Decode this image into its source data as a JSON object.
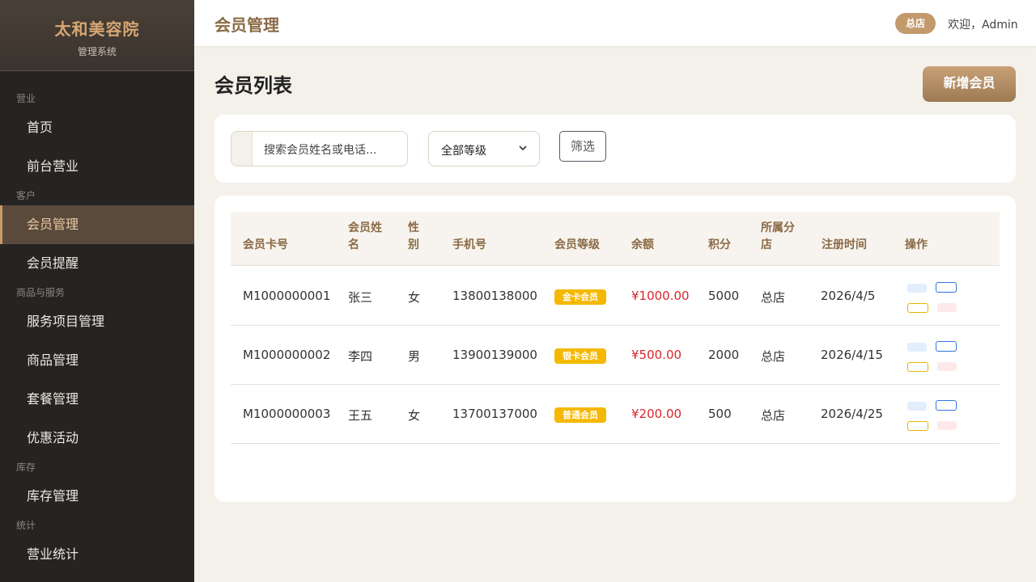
{
  "sidebar": {
    "brand": "太和美容院",
    "subtitle": "管理系统",
    "groups": [
      {
        "label": "营业",
        "items": [
          "首页",
          "前台营业"
        ]
      },
      {
        "label": "客户",
        "items": [
          "会员管理",
          "会员提醒"
        ]
      },
      {
        "label": "商品与服务",
        "items": [
          "服务项目管理",
          "商品管理",
          "套餐管理",
          "优惠活动"
        ]
      },
      {
        "label": "库存",
        "items": [
          "库存管理"
        ]
      },
      {
        "label": "统计",
        "items": [
          "营业统计"
        ]
      }
    ],
    "active_item": "会员管理"
  },
  "header": {
    "title": "会员管理",
    "store_badge": "总店",
    "welcome": "欢迎，Admin"
  },
  "main": {
    "page_title": "会员列表",
    "add_button": "新增会员"
  },
  "filters": {
    "search_placeholder": "搜索会员姓名或电话...",
    "level_selected": "全部等级",
    "filter_button": "筛选"
  },
  "table": {
    "columns": [
      "会员卡号",
      "会员姓名",
      "性别",
      "手机号",
      "会员等级",
      "余额",
      "积分",
      "所属分店",
      "注册时间",
      "操作"
    ],
    "rows": [
      {
        "card": "M1000000001",
        "name": "张三",
        "gender": "女",
        "phone": "13800138000",
        "level": "金卡会员",
        "balance": "¥1000.00",
        "points": "5000",
        "store": "总店",
        "registered": "2026/4/5"
      },
      {
        "card": "M1000000002",
        "name": "李四",
        "gender": "男",
        "phone": "13900139000",
        "level": "银卡会员",
        "balance": "¥500.00",
        "points": "2000",
        "store": "总店",
        "registered": "2026/4/15"
      },
      {
        "card": "M1000000003",
        "name": "王五",
        "gender": "女",
        "phone": "13700137000",
        "level": "普通会员",
        "balance": "¥200.00",
        "points": "500",
        "store": "总店",
        "registered": "2026/4/25"
      }
    ]
  },
  "colors": {
    "accent": "#8b6a45",
    "sidebar_bg": "#262422",
    "badge": "#f5b800",
    "money": "#d9262c"
  }
}
